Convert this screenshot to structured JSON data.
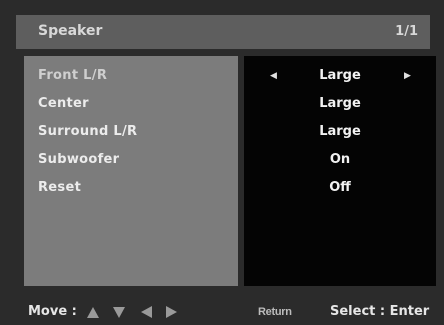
{
  "header": {
    "title": "Speaker",
    "page": "1/1"
  },
  "menu": {
    "items": [
      {
        "label": "Front L/R",
        "value": "Large"
      },
      {
        "label": "Center",
        "value": "Large"
      },
      {
        "label": "Surround L/R",
        "value": "Large"
      },
      {
        "label": "Subwoofer",
        "value": "On"
      },
      {
        "label": "Reset",
        "value": "Off"
      }
    ],
    "selected_index": 0
  },
  "footer": {
    "move_label": "Move :",
    "return_label": "Return",
    "select_label": "Select : Enter"
  },
  "icons": {
    "left_arrow": "triangle-left-icon",
    "right_arrow": "triangle-right-icon",
    "move_up": "triangle-up-icon",
    "move_down": "triangle-down-icon",
    "move_left": "triangle-left-icon",
    "move_right": "triangle-right-icon"
  },
  "colors": {
    "header_bg": "#5e5e5e",
    "label_panel_bg": "#7c7c7c",
    "value_panel_bg": "#040404"
  }
}
